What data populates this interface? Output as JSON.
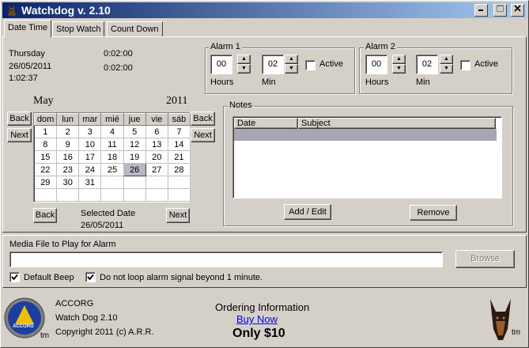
{
  "window": {
    "title": "Watchdog v. 2.10"
  },
  "tabs": [
    {
      "label": "Date Time"
    },
    {
      "label": "Stop Watch"
    },
    {
      "label": "Count Down"
    }
  ],
  "datetime": {
    "day": "Thursday",
    "date": "26/05/2011",
    "time": "1:02:37",
    "counter1": "0:02:00",
    "counter2": "0:02:00"
  },
  "alarm1": {
    "title": "Alarm 1",
    "hours": "00",
    "min": "02",
    "hours_label": "Hours",
    "min_label": "Min",
    "active_label": "Active"
  },
  "alarm2": {
    "title": "Alarm 2",
    "hours": "00",
    "min": "02",
    "hours_label": "Hours",
    "min_label": "Min",
    "active_label": "Active"
  },
  "calendar": {
    "month": "May",
    "year": "2011",
    "back_label": "Back",
    "next_label": "Next",
    "headers": [
      "dom",
      "lun",
      "mar",
      "mié",
      "jue",
      "vie",
      "sáb"
    ],
    "rows": [
      [
        "1",
        "2",
        "3",
        "4",
        "5",
        "6",
        "7"
      ],
      [
        "8",
        "9",
        "10",
        "11",
        "12",
        "13",
        "14"
      ],
      [
        "15",
        "16",
        "17",
        "18",
        "19",
        "20",
        "21"
      ],
      [
        "22",
        "23",
        "24",
        "25",
        "26",
        "27",
        "28"
      ],
      [
        "29",
        "30",
        "31",
        "",
        "",
        "",
        ""
      ],
      [
        "",
        "",
        "",
        "",
        "",
        "",
        ""
      ]
    ],
    "selected": "26",
    "selected_caption": "Selected Date",
    "selected_value": "26/05/2011"
  },
  "notes": {
    "title": "Notes",
    "columns": [
      "Date",
      "Subject"
    ],
    "add_label": "Add / Edit",
    "remove_label": "Remove"
  },
  "media": {
    "label": "Media File to Play for Alarm",
    "value": "",
    "browse_label": "Browse",
    "default_beep_label": "Default Beep",
    "no_loop_label": "Do not loop alarm signal beyond 1 minute."
  },
  "footer": {
    "logo_text": "ACCORG",
    "tm": "tm",
    "company": "ACCORG",
    "product": "Watch Dog 2.10",
    "copyright": "Copyright 2011 (c) A.R.R.",
    "ordering": "Ordering Information",
    "buy_now": "Buy Now",
    "price": "Only $10"
  },
  "colors": {
    "title_start": "#0a246a",
    "title_end": "#a6caf0",
    "face": "#d4d0c8",
    "link": "#0000ff",
    "selected_row": "#a6a6b4"
  }
}
